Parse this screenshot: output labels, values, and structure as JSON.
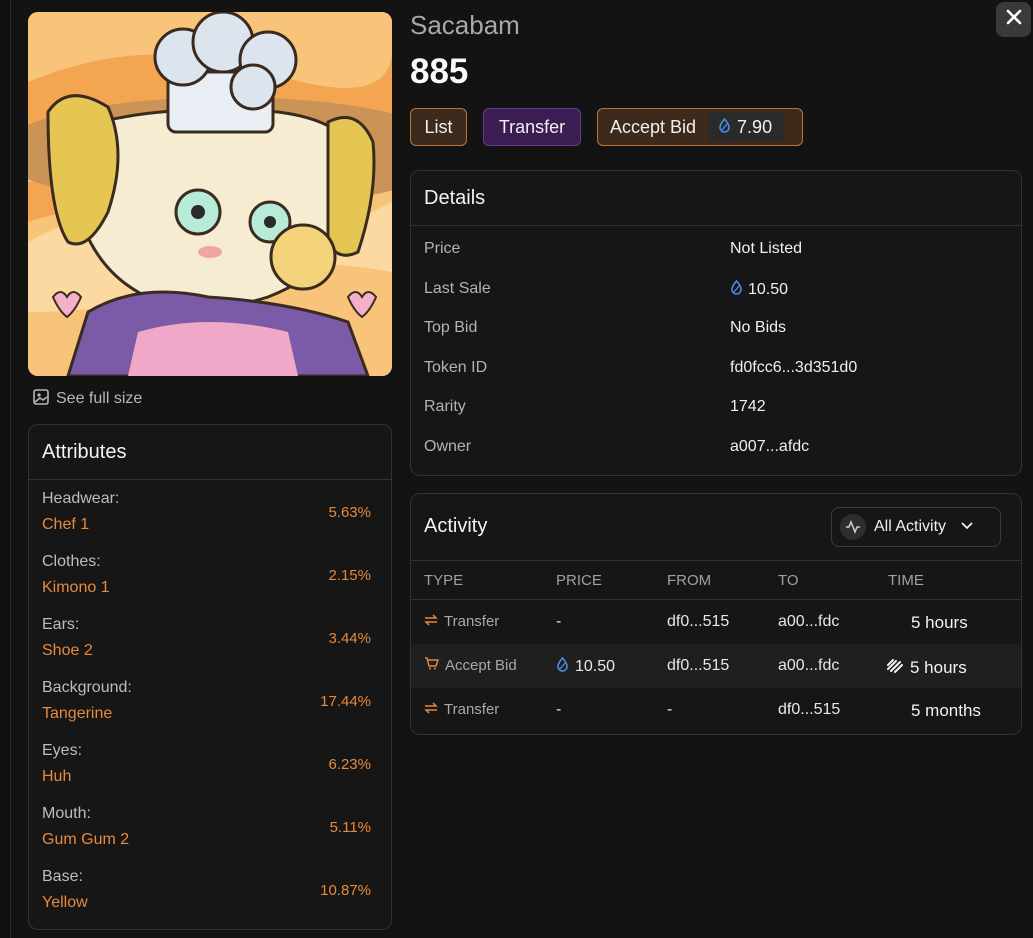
{
  "collection_name": "Sacabam",
  "token_number": "885",
  "actions": {
    "list_label": "List",
    "transfer_label": "Transfer",
    "accept_bid_label": "Accept Bid",
    "accept_bid_amount": "7.90"
  },
  "see_full_size_label": "See full size",
  "attributes": {
    "title": "Attributes",
    "items": [
      {
        "label": "Headwear:",
        "value": "Chef 1",
        "pct": "5.63%"
      },
      {
        "label": "Clothes:",
        "value": "Kimono 1",
        "pct": "2.15%"
      },
      {
        "label": "Ears:",
        "value": "Shoe 2",
        "pct": "3.44%"
      },
      {
        "label": "Background:",
        "value": "Tangerine",
        "pct": "17.44%"
      },
      {
        "label": "Eyes:",
        "value": "Huh",
        "pct": "6.23%"
      },
      {
        "label": "Mouth:",
        "value": "Gum Gum 2",
        "pct": "5.11%"
      },
      {
        "label": "Base:",
        "value": "Yellow",
        "pct": "10.87%"
      }
    ]
  },
  "details": {
    "title": "Details",
    "rows": [
      {
        "key": "Price",
        "value": "Not Listed"
      },
      {
        "key": "Last Sale",
        "value": "10.50"
      },
      {
        "key": "Top Bid",
        "value": "No Bids"
      },
      {
        "key": "Token ID",
        "value": "fd0fcc6...3d351d0"
      },
      {
        "key": "Rarity",
        "value": "1742"
      },
      {
        "key": "Owner",
        "value": "a007...afdc"
      }
    ]
  },
  "activity": {
    "title": "Activity",
    "filter_label": "All Activity",
    "columns": [
      "TYPE",
      "PRICE",
      "FROM",
      "TO",
      "TIME"
    ],
    "rows": [
      {
        "type": "Transfer",
        "price": "-",
        "from": "df0...515",
        "to": "a00...fdc",
        "time": "5 hours"
      },
      {
        "type": "Accept Bid",
        "price": "10.50",
        "from": "df0...515",
        "to": "a00...fdc",
        "time": "5 hours"
      },
      {
        "type": "Transfer",
        "price": "-",
        "from": "-",
        "to": "df0...515",
        "time": "5 months"
      }
    ]
  },
  "colors": {
    "accent_orange": "#e8893c",
    "token_blue": "#4a8fe8",
    "list_bg": "#3d2a1a",
    "transfer_bg": "#3a1d52"
  }
}
